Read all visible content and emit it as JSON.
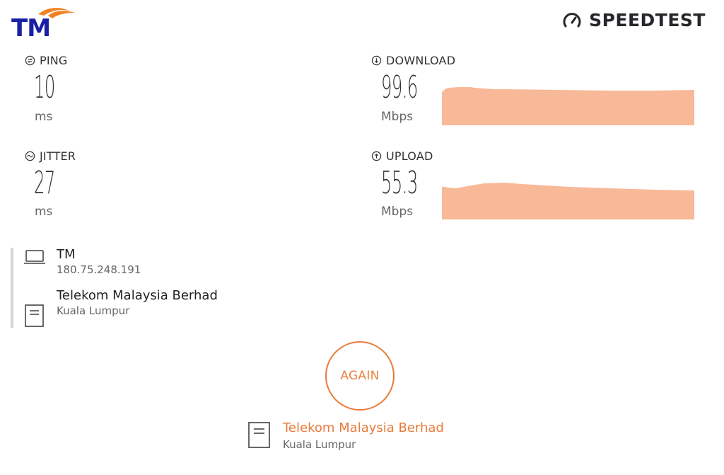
{
  "brand": {
    "logo_text": "TM",
    "speedtest_label": "SPEEDTEST",
    "accent": "#ea7a3a",
    "graph_fill": "#f8b998",
    "logo_blue": "#1a1fa3",
    "logo_orange": "#f28222"
  },
  "metrics": {
    "ping": {
      "label": "PING",
      "value": "10",
      "unit": "ms",
      "icon": "ping-icon"
    },
    "jitter": {
      "label": "JITTER",
      "value": "27",
      "unit": "ms",
      "icon": "jitter-icon"
    },
    "download": {
      "label": "DOWNLOAD",
      "value": "99.6",
      "unit": "Mbps",
      "icon": "download-arrow-icon"
    },
    "upload": {
      "label": "UPLOAD",
      "value": "55.3",
      "unit": "Mbps",
      "icon": "upload-arrow-icon"
    }
  },
  "connection": {
    "isp": {
      "name": "TM",
      "ip": "180.75.248.191",
      "icon": "laptop-icon"
    },
    "server": {
      "name": "Telekom Malaysia Berhad",
      "location": "Kuala Lumpur",
      "icon": "server-icon"
    }
  },
  "action": {
    "again_label": "AGAIN"
  },
  "selected_server": {
    "name": "Telekom Malaysia Berhad",
    "location": "Kuala Lumpur",
    "icon": "server-icon"
  }
}
